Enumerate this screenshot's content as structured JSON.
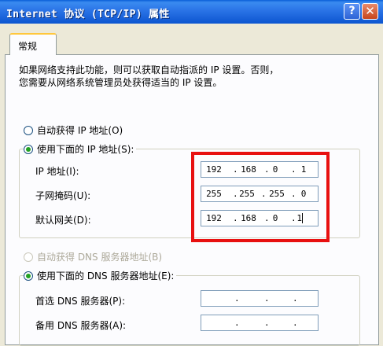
{
  "window": {
    "title": "Internet 协议 (TCP/IP) 属性",
    "help_glyph": "?",
    "close_glyph": "✕"
  },
  "tab": {
    "label": "常规"
  },
  "description": {
    "line1": "如果网络支持此功能，则可以获取自动指派的 IP 设置。否则，",
    "line2": "您需要从网络系统管理员处获得适当的 IP 设置。"
  },
  "ip_mode": {
    "auto_label": "自动获得 IP 地址(O)",
    "manual_label": "使用下面的 IP 地址(S):",
    "selected": "manual"
  },
  "ip_fields": [
    {
      "label": "IP 地址(I):",
      "octets": [
        "192",
        "168",
        "0",
        "1"
      ]
    },
    {
      "label": "子网掩码(U):",
      "octets": [
        "255",
        "255",
        "255",
        "0"
      ]
    },
    {
      "label": "默认网关(D):",
      "octets": [
        "192",
        "168",
        "0",
        "1"
      ]
    }
  ],
  "dns_mode": {
    "auto_label": "自动获得 DNS 服务器地址(B)",
    "manual_label": "使用下面的 DNS 服务器地址(E):",
    "selected": "manual",
    "auto_disabled": true
  },
  "dns_fields": [
    {
      "label": "首选 DNS 服务器(P):",
      "octets": [
        "",
        "",
        "",
        ""
      ]
    },
    {
      "label": "备用 DNS 服务器(A):",
      "octets": [
        "",
        "",
        "",
        ""
      ]
    }
  ],
  "octet_separator": ".",
  "colors": {
    "highlight_frame": "#e81010",
    "titlebar": "#2a73e6"
  }
}
